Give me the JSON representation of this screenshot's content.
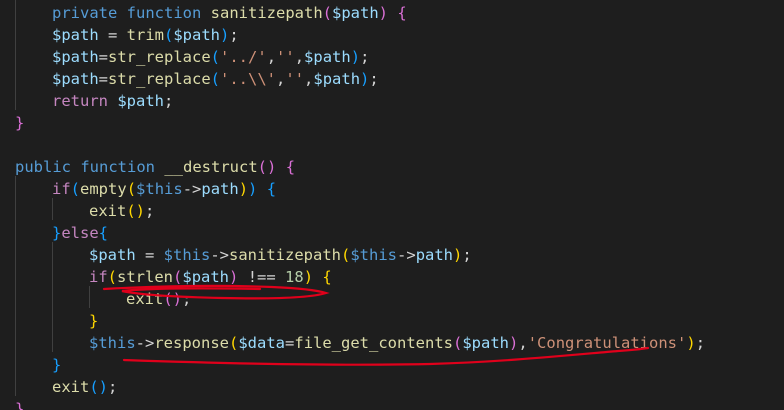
{
  "editor": {
    "lines": [
      [
        [
          "private",
          "kw"
        ],
        [
          " ",
          "op"
        ],
        [
          "function",
          "kw"
        ],
        [
          " ",
          "op"
        ],
        [
          "sanitizepath",
          "fn"
        ],
        [
          "(",
          "p2"
        ],
        [
          "$path",
          "var"
        ],
        [
          ")",
          "p2"
        ],
        [
          " ",
          "op"
        ],
        [
          "{",
          "p2"
        ]
      ],
      [
        [
          "$path",
          "var"
        ],
        [
          " = ",
          "op"
        ],
        [
          "trim",
          "fn"
        ],
        [
          "(",
          "p3"
        ],
        [
          "$path",
          "var"
        ],
        [
          ")",
          "p3"
        ],
        [
          ";",
          "op"
        ]
      ],
      [
        [
          "$path",
          "var"
        ],
        [
          "=",
          "op"
        ],
        [
          "str_replace",
          "fn"
        ],
        [
          "(",
          "p3"
        ],
        [
          "'../'",
          "str"
        ],
        [
          ",",
          "op"
        ],
        [
          "''",
          "str"
        ],
        [
          ",",
          "op"
        ],
        [
          "$path",
          "var"
        ],
        [
          ")",
          "p3"
        ],
        [
          ";",
          "op"
        ]
      ],
      [
        [
          "$path",
          "var"
        ],
        [
          "=",
          "op"
        ],
        [
          "str_replace",
          "fn"
        ],
        [
          "(",
          "p3"
        ],
        [
          "'..\\\\'",
          "str"
        ],
        [
          ",",
          "op"
        ],
        [
          "''",
          "str"
        ],
        [
          ",",
          "op"
        ],
        [
          "$path",
          "var"
        ],
        [
          ")",
          "p3"
        ],
        [
          ";",
          "op"
        ]
      ],
      [
        [
          "return",
          "ctl"
        ],
        [
          " ",
          "op"
        ],
        [
          "$path",
          "var"
        ],
        [
          ";",
          "op"
        ]
      ],
      [
        [
          "}",
          "p2"
        ]
      ],
      [],
      [
        [
          "public",
          "kw"
        ],
        [
          " ",
          "op"
        ],
        [
          "function",
          "kw"
        ],
        [
          " ",
          "op"
        ],
        [
          "__destruct",
          "fn"
        ],
        [
          "(",
          "p2"
        ],
        [
          ")",
          "p2"
        ],
        [
          " ",
          "op"
        ],
        [
          "{",
          "p2"
        ]
      ],
      [
        [
          "if",
          "ctl"
        ],
        [
          "(",
          "p3"
        ],
        [
          "empty",
          "fn"
        ],
        [
          "(",
          "p1"
        ],
        [
          "$this",
          "kw"
        ],
        [
          "->",
          "op"
        ],
        [
          "path",
          "var"
        ],
        [
          ")",
          "p1"
        ],
        [
          ")",
          "p3"
        ],
        [
          " ",
          "op"
        ],
        [
          "{",
          "p3"
        ]
      ],
      [
        [
          "exit",
          "fn"
        ],
        [
          "(",
          "p1"
        ],
        [
          ")",
          "p1"
        ],
        [
          ";",
          "op"
        ]
      ],
      [
        [
          "}",
          "p3"
        ],
        [
          "else",
          "ctl"
        ],
        [
          "{",
          "p3"
        ]
      ],
      [
        [
          "$path",
          "var"
        ],
        [
          " = ",
          "op"
        ],
        [
          "$this",
          "kw"
        ],
        [
          "->",
          "op"
        ],
        [
          "sanitizepath",
          "fn"
        ],
        [
          "(",
          "p1"
        ],
        [
          "$this",
          "kw"
        ],
        [
          "->",
          "op"
        ],
        [
          "path",
          "var"
        ],
        [
          ")",
          "p1"
        ],
        [
          ";",
          "op"
        ]
      ],
      [
        [
          "if",
          "ctl"
        ],
        [
          "(",
          "p1"
        ],
        [
          "strlen",
          "fn"
        ],
        [
          "(",
          "p2"
        ],
        [
          "$path",
          "var"
        ],
        [
          ")",
          "p2"
        ],
        [
          " !== ",
          "op"
        ],
        [
          "18",
          "num"
        ],
        [
          ")",
          "p1"
        ],
        [
          " ",
          "op"
        ],
        [
          "{",
          "p1"
        ]
      ],
      [
        [
          "exit",
          "fn"
        ],
        [
          "(",
          "p2"
        ],
        [
          ")",
          "p2"
        ],
        [
          ";",
          "op"
        ]
      ],
      [
        [
          "}",
          "p1"
        ]
      ],
      [
        [
          "$this",
          "kw"
        ],
        [
          "->",
          "op"
        ],
        [
          "response",
          "fn"
        ],
        [
          "(",
          "p1"
        ],
        [
          "$data",
          "var"
        ],
        [
          "=",
          "op"
        ],
        [
          "file_get_contents",
          "fn"
        ],
        [
          "(",
          "p2"
        ],
        [
          "$path",
          "var"
        ],
        [
          ")",
          "p2"
        ],
        [
          ",",
          "op"
        ],
        [
          "'Congratulations'",
          "str"
        ],
        [
          ")",
          "p1"
        ],
        [
          ";",
          "op"
        ]
      ],
      [
        [
          "}",
          "p3"
        ]
      ],
      [
        [
          "exit",
          "fn"
        ],
        [
          "(",
          "p3"
        ],
        [
          ")",
          "p3"
        ],
        [
          ";",
          "op"
        ]
      ],
      [
        [
          "}",
          "p2"
        ]
      ]
    ]
  }
}
